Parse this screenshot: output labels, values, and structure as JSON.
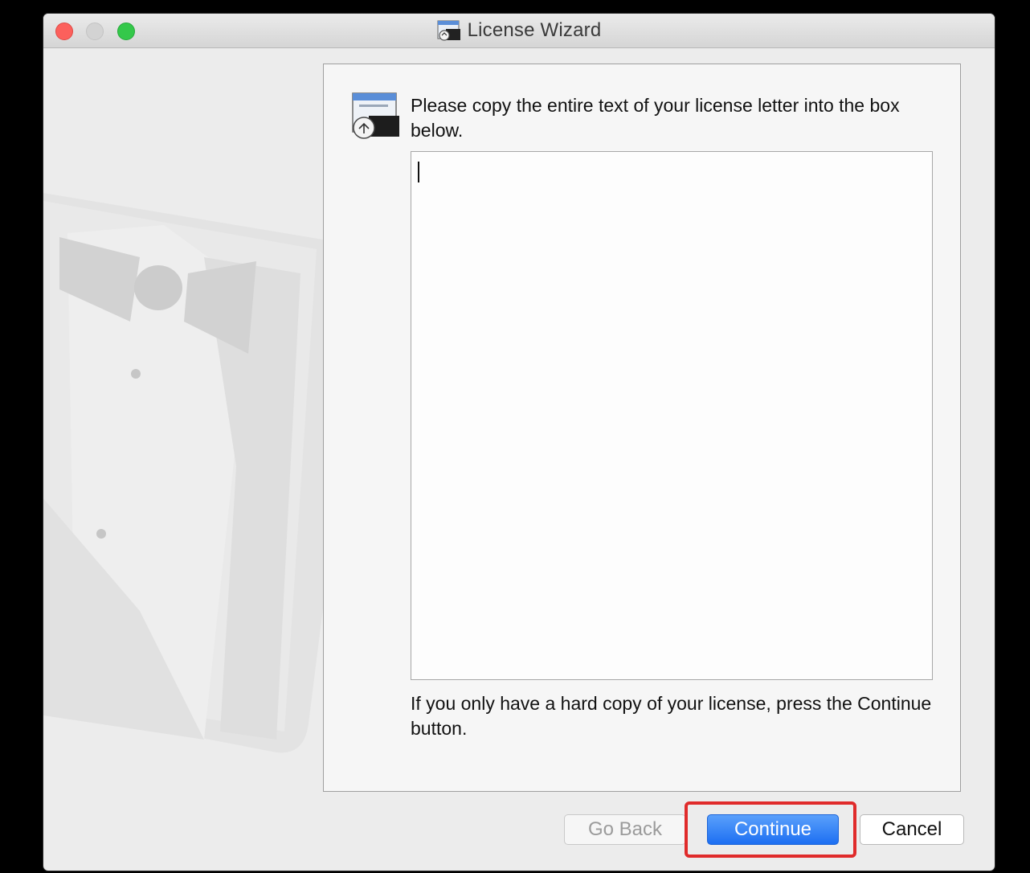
{
  "window": {
    "title": "License Wizard",
    "icon": "license-wizard-icon"
  },
  "traffic_lights": {
    "close_color": "#fc605c",
    "minimize_color": "#d3d3d3",
    "zoom_color": "#34c84a"
  },
  "content": {
    "icon": "license-document-icon",
    "instruction": "Please copy the entire text of your license letter into the box below.",
    "license_text_value": "",
    "hardcopy_note": "If you only have a hard copy of your license, press the Continue button."
  },
  "buttons": {
    "go_back_label": "Go Back",
    "continue_label": "Continue",
    "cancel_label": "Cancel"
  },
  "annotation": {
    "highlight_color": "#e02b2b",
    "target": "continue-button"
  },
  "colors": {
    "accent": "#1d6ff2",
    "window_bg": "#ececec"
  }
}
